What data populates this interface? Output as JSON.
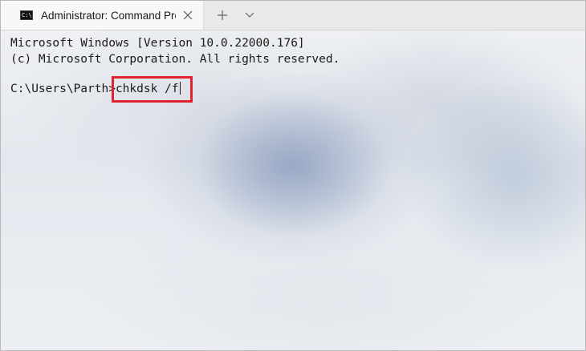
{
  "tab": {
    "title": "Administrator: Command Prompt",
    "icon": "cmd-icon",
    "icon_text": "C:\\."
  },
  "tabstrip": {
    "close_icon": "close-icon",
    "new_tab_icon": "plus-icon",
    "dropdown_icon": "chevron-down-icon"
  },
  "terminal": {
    "lines": [
      "Microsoft Windows [Version 10.0.22000.176]",
      "(c) Microsoft Corporation. All rights reserved."
    ],
    "prompt": "C:\\Users\\Parth>",
    "command": "chkdsk /f"
  },
  "colors": {
    "highlight": "#e0242f",
    "text": "#1a1a1a"
  }
}
